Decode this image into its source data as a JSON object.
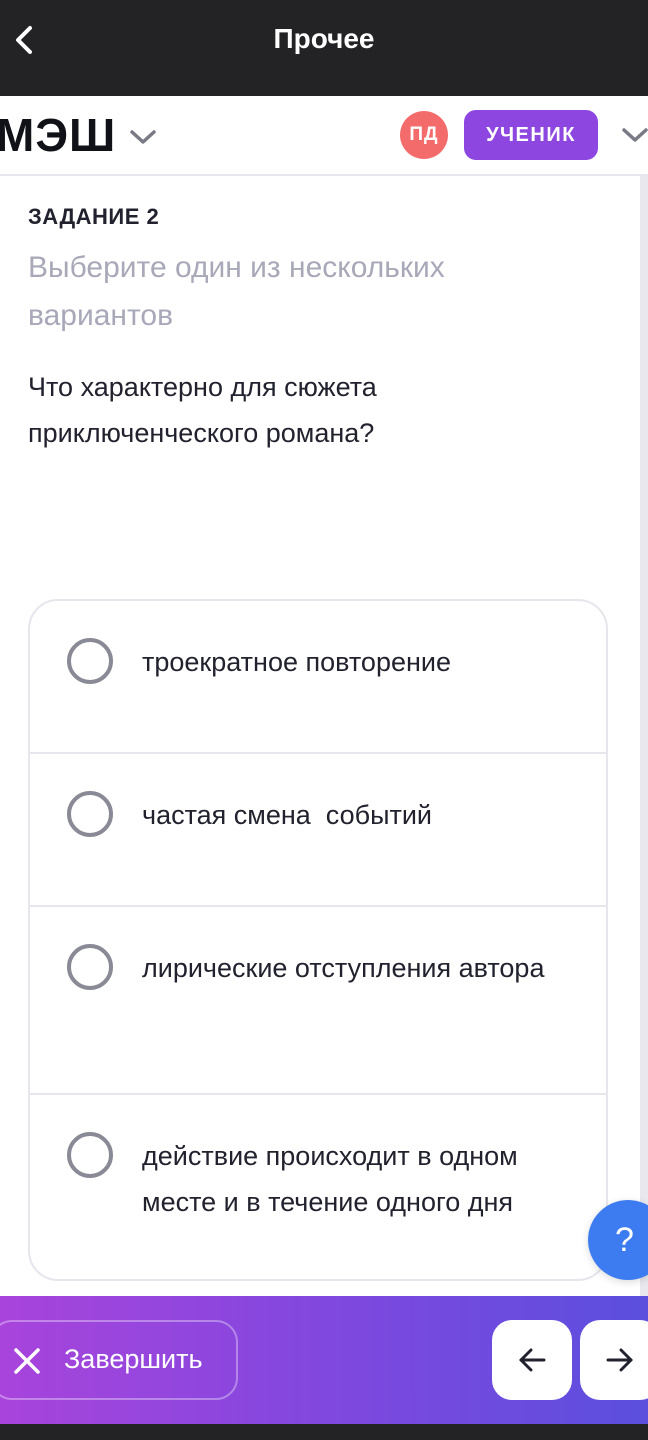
{
  "topbar": {
    "title": "Прочее"
  },
  "header": {
    "logo_text": "МЭШ",
    "avatar_initials": "ПД",
    "role_label": "УЧЕНИК"
  },
  "task": {
    "label": "ЗАДАНИЕ 2",
    "instruction": "Выберите один из нескольких вариантов",
    "question": "Что характерно для сюжета приключенческого романа?",
    "options": [
      {
        "text": "троекратное повторение",
        "selected": false
      },
      {
        "text": "частая смена  событий",
        "selected": false
      },
      {
        "text": "лирические отступления автора",
        "selected": false
      },
      {
        "text": "действие происходит в одном месте и в течение одного дня",
        "selected": false
      }
    ]
  },
  "help": {
    "label": "?"
  },
  "footer": {
    "finish_label": "Завершить"
  },
  "icons": {
    "back": "chevron-left-icon",
    "dropdown": "chevron-down-icon",
    "finish": "close-icon",
    "prev": "arrow-left-icon",
    "next": "arrow-right-icon"
  },
  "colors": {
    "topbar": "#232325",
    "avatar": "#f36b6b",
    "role_badge": "#8d47e0",
    "help_button": "#3d7cf0",
    "footer_gradient_start": "#a844dc",
    "footer_gradient_end": "#5b4fde"
  }
}
